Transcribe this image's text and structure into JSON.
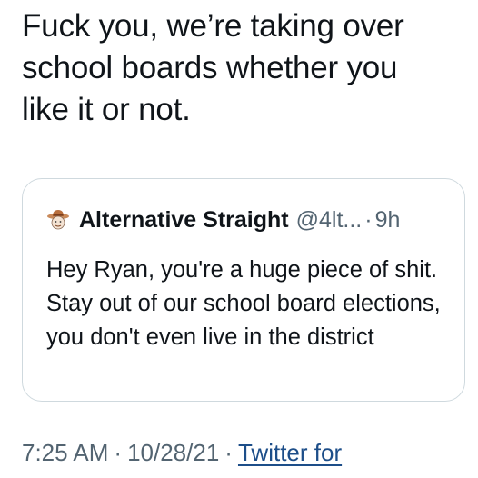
{
  "tweet": {
    "text": "Fuck you, we’re taking over\nschool boards whether you\nlike it or not."
  },
  "quote": {
    "avatar_icon": "cowboy-hat-avatar-icon",
    "name": "Alternative Straight",
    "handle": "@4lt...",
    "separator": "·",
    "time": "9h",
    "text": "Hey Ryan, you're a huge piece of shit. Stay out of our school board elections, you don't even live in the district"
  },
  "meta": {
    "time": "7:25 AM",
    "separator": "·",
    "date": "10/28/21",
    "source_link": "Twitter for"
  },
  "colors": {
    "text_primary": "#0f1419",
    "text_secondary": "#536471",
    "border": "#cfd9de",
    "link": "#1d4e89"
  }
}
